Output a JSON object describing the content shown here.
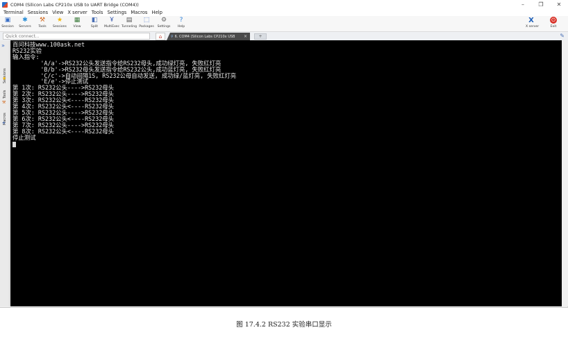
{
  "window": {
    "title": "COM4  (Silicon Labs CP210x USB to UART Bridge (COM4))",
    "minimize": "–",
    "restore": "❐",
    "close": "✕"
  },
  "menu": [
    "Terminal",
    "Sessions",
    "View",
    "X server",
    "Tools",
    "Settings",
    "Macros",
    "Help"
  ],
  "toolbar": {
    "tools": [
      {
        "name": "session",
        "label": "Session",
        "icon": "session-icon",
        "glyph": "▣",
        "color": "#3a6fc6"
      },
      {
        "name": "servers",
        "label": "Servers",
        "icon": "servers-icon",
        "glyph": "✱",
        "color": "#2a8fd8"
      },
      {
        "name": "tools",
        "label": "Tools",
        "icon": "tools-icon",
        "glyph": "⚒",
        "color": "#d2691e"
      },
      {
        "name": "sessions",
        "label": "Sessions",
        "icon": "star-icon",
        "glyph": "★",
        "color": "#f2b705"
      },
      {
        "name": "view",
        "label": "View",
        "icon": "view-icon",
        "glyph": "▦",
        "color": "#3d7c3d"
      },
      {
        "name": "split",
        "label": "Split",
        "icon": "split-icon",
        "glyph": "◧",
        "color": "#4a6fb5"
      },
      {
        "name": "multiexec",
        "label": "MultiExec",
        "icon": "multiexec-icon",
        "glyph": "Ұ",
        "color": "#2a4fa8"
      },
      {
        "name": "tunneling",
        "label": "Tunneling",
        "icon": "tunneling-icon",
        "glyph": "▤",
        "color": "#555555"
      },
      {
        "name": "packages",
        "label": "Packages",
        "icon": "packages-icon",
        "glyph": "⬚",
        "color": "#3c6cc4"
      },
      {
        "name": "settings",
        "label": "Settings",
        "icon": "gear-icon",
        "glyph": "⚙",
        "color": "#666666"
      },
      {
        "name": "help",
        "label": "Help",
        "icon": "help-icon",
        "glyph": "?",
        "color": "#2a7fd8"
      }
    ],
    "xserver_label": "X server",
    "exit_label": "Exit"
  },
  "quickbar": {
    "placeholder": "Quick connect...",
    "session_tab": "6. COM4  (Silicon Labs CP210x USB",
    "tab_close": "×",
    "new_tab": "+"
  },
  "sidebar": {
    "arrows": "»",
    "tabs": [
      "Sessions",
      "Tools",
      "Macros"
    ]
  },
  "terminal": {
    "lines": [
      "百问科技www.100ask.net",
      "RS232实验",
      "输入指令:",
      "        'A/a'->RS232公头发送指令给RS232母头,成功绿灯亮, 失败红灯亮",
      "        'B/b'->RS232母头发送指令给RS232公头,成功蓝灯亮, 失败红灯亮",
      "        'C/c'->自动间隔1S, RS232公母自动发送, 成功绿/蓝灯亮, 失败红灯亮",
      "        'E/e'->停止测试",
      "第 1次: RS232公头---->RS232母头",
      "第 2次: RS232公头---->RS232母头",
      "第 3次: RS232公头<----RS232母头",
      "第 4次: RS232公头<----RS232母头",
      "第 5次: RS232公头---->RS232母头",
      "第 6次: RS232公头<----RS232母头",
      "第 7次: RS232公头---->RS232母头",
      "第 8次: RS232公头<----RS232母头",
      "停止测试"
    ]
  },
  "caption": "图  17.4.2 RS232 实验串口显示"
}
